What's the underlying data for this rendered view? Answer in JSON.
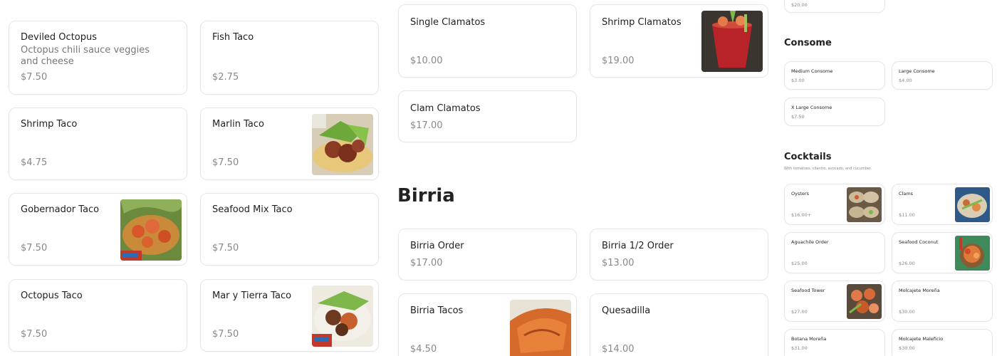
{
  "tacos": {
    "deviled_octopus": {
      "name": "Deviled Octopus",
      "desc": "Octopus chili sauce veggies and cheese",
      "price": "$7.50"
    },
    "fish_taco": {
      "name": "Fish Taco",
      "price": "$2.75"
    },
    "shrimp_taco": {
      "name": "Shrimp Taco",
      "price": "$4.75"
    },
    "marlin_taco": {
      "name": "Marlin Taco",
      "price": "$7.50"
    },
    "gobernador_taco": {
      "name": "Gobernador Taco",
      "price": "$7.50"
    },
    "seafood_mix_taco": {
      "name": "Seafood Mix Taco",
      "price": "$7.50"
    },
    "octopus_taco": {
      "name": "Octopus Taco",
      "price": "$7.50"
    },
    "mar_y_tierra_taco": {
      "name": "Mar y Tierra Taco",
      "price": "$7.50"
    }
  },
  "clamatos": {
    "single": {
      "name": "Single Clamatos",
      "price": "$10.00"
    },
    "shrimp": {
      "name": "Shrimp Clamatos",
      "price": "$19.00"
    },
    "clam": {
      "name": "Clam Clamatos",
      "price": "$17.00"
    }
  },
  "birria": {
    "heading": "Birria",
    "order": {
      "name": "Birria Order",
      "price": "$17.00"
    },
    "half_order": {
      "name": "Birria 1/2 Order",
      "price": "$13.00"
    },
    "tacos": {
      "name": "Birria Tacos",
      "price": "$4.50"
    },
    "quesadilla": {
      "name": "Quesadilla",
      "price": "$14.00"
    }
  },
  "right_column": {
    "top_price": "$20.00",
    "consome": {
      "heading": "Consome",
      "medium": {
        "name": "Medium Consome",
        "price": "$3.00"
      },
      "large": {
        "name": "Large Consome",
        "price": "$4.00"
      },
      "xlarge": {
        "name": "X Large Consome",
        "price": "$7.50"
      }
    },
    "cocktails": {
      "heading": "Cocktails",
      "note": "With tomatoes, cilantro, avocado, and cucumber.",
      "oysters": {
        "name": "Oysters",
        "price": "$16.00+"
      },
      "clams": {
        "name": "Clams",
        "price": "$11.00"
      },
      "aguachile": {
        "name": "Aguachile Order",
        "price": "$25.00"
      },
      "seafood_coconut": {
        "name": "Seafood Coconut",
        "price": "$26.00"
      },
      "seafood_tower": {
        "name": "Seafood Tower",
        "price": "$27.00"
      },
      "molcajete_morena": {
        "name": "Molcajete Moreña",
        "price": "$30.00"
      },
      "botana_morena": {
        "name": "Botana Moreña",
        "price": "$31.00"
      },
      "molcajete_maleficio": {
        "name": "Molcajete Maleficio",
        "price": "$30.00"
      }
    }
  }
}
